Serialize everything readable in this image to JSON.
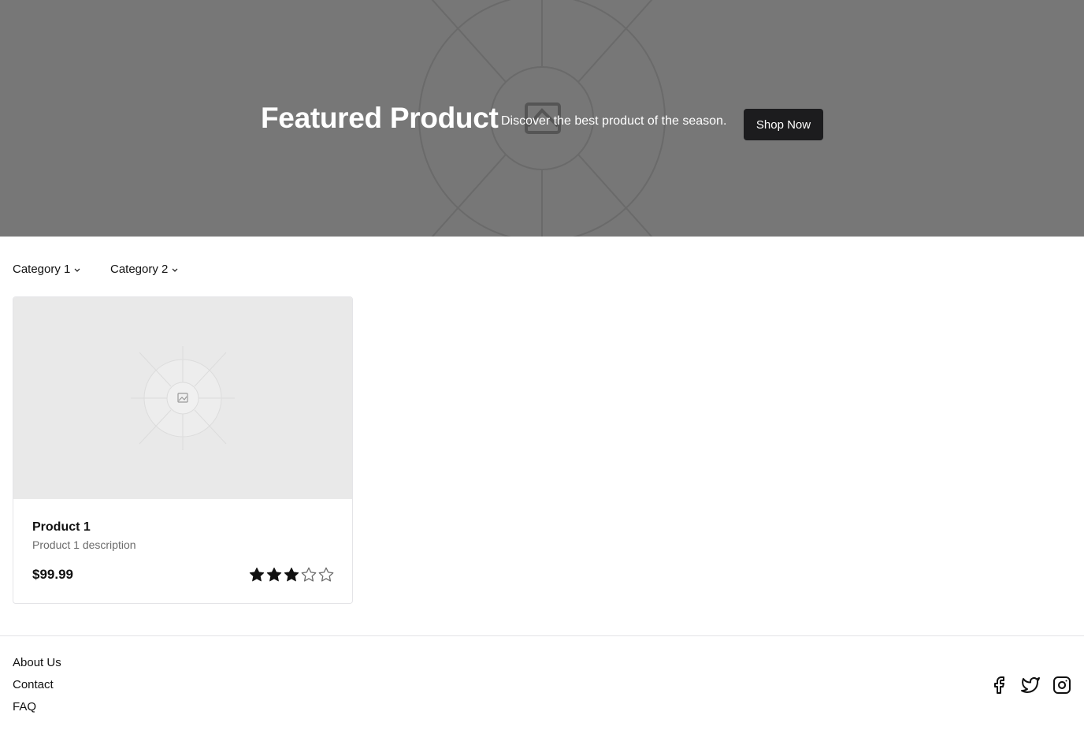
{
  "hero": {
    "title": "Featured Product",
    "subtitle": "Discover the best product of the season.",
    "cta_label": "Shop Now",
    "background_color": "#777777",
    "image_icon": "image-placeholder-icon"
  },
  "filters": [
    {
      "label": "Category 1",
      "icon": "chevron-down-icon"
    },
    {
      "label": "Category 2",
      "icon": "chevron-down-icon"
    }
  ],
  "products": [
    {
      "name": "Product 1",
      "description": "Product 1 description",
      "price": "$99.99",
      "rating": 3,
      "rating_max": 5,
      "image_icon": "image-placeholder-icon"
    }
  ],
  "footer": {
    "links": [
      "About Us",
      "Contact",
      "FAQ"
    ],
    "social": [
      "facebook-icon",
      "twitter-icon",
      "instagram-icon"
    ]
  },
  "colors": {
    "button_bg": "#1c1c1e",
    "star_filled": "#111111",
    "star_empty": "#6b6b6b",
    "muted_text": "#6b6b6b"
  }
}
